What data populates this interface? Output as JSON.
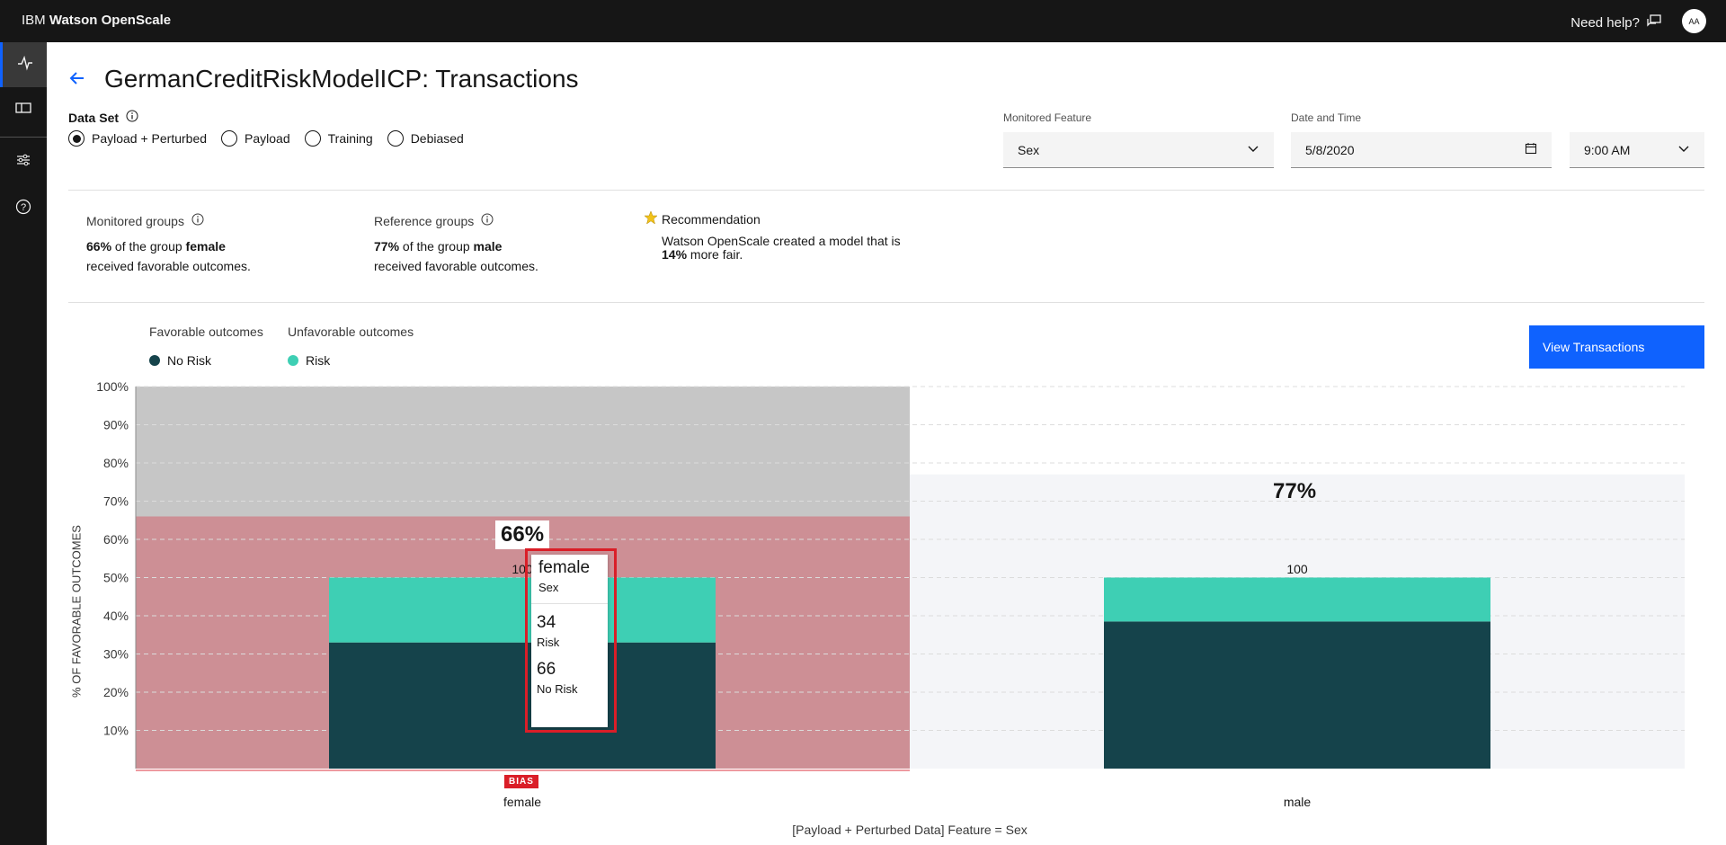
{
  "header": {
    "brand_prefix": "IBM",
    "brand_name": "Watson OpenScale",
    "help_label": "Need help?",
    "avatar_initials": "AA"
  },
  "page": {
    "title": "GermanCreditRiskModelICP: Transactions"
  },
  "dataset": {
    "label": "Data Set",
    "options": [
      "Payload + Perturbed",
      "Payload",
      "Training",
      "Debiased"
    ],
    "selected": "Payload + Perturbed"
  },
  "filters": {
    "monitored_feature_label": "Monitored Feature",
    "monitored_feature_value": "Sex",
    "date_label": "Date and Time",
    "date_value": "5/8/2020",
    "time_value": "9:00 AM"
  },
  "summary": {
    "monitored_label": "Monitored groups",
    "monitored_pct": "66%",
    "monitored_text_a": "of the group",
    "monitored_group": "female",
    "monitored_text_b": "received favorable outcomes.",
    "reference_label": "Reference groups",
    "reference_pct": "77%",
    "reference_text_a": "of the group",
    "reference_group": "male",
    "reference_text_b": "received favorable outcomes.",
    "recommendation_label": "Recommendation",
    "recommendation_text_a": "Watson OpenScale created a model that is",
    "recommendation_pct": "14%",
    "recommendation_text_b": "more fair."
  },
  "legend": {
    "favorable_label": "Favorable outcomes",
    "favorable_item": "No Risk",
    "unfavorable_label": "Unfavorable outcomes",
    "unfavorable_item": "Risk"
  },
  "actions": {
    "view_transactions": "View Transactions"
  },
  "colors": {
    "no_risk": "#15434b",
    "risk": "#3ecfb4",
    "bias_region": "#cd8f95",
    "unfav_region": "#c6c6c6",
    "accent": "#0f62fe",
    "bias_red": "#da1e28"
  },
  "chart_data": {
    "type": "bar",
    "categories": [
      "female",
      "male"
    ],
    "yticks": [
      "10%",
      "20%",
      "30%",
      "40%",
      "50%",
      "60%",
      "70%",
      "80%",
      "90%",
      "100%"
    ],
    "ylim": [
      0,
      100
    ],
    "ylabel": "% OF FAVORABLE OUTCOMES",
    "xlabel": "[Payload + Perturbed Data] Feature = Sex",
    "favorable_pct": [
      66,
      77
    ],
    "bar_top_labels": [
      "100",
      "100"
    ],
    "series": [
      {
        "name": "No Risk",
        "values": [
          66,
          77
        ]
      },
      {
        "name": "Risk",
        "values": [
          34,
          23
        ]
      }
    ],
    "bias_badge": "BIAS",
    "pct_labels": [
      "66%",
      "77%"
    ],
    "tooltip": {
      "group": "female",
      "feature": "Sex",
      "risk_value": "34",
      "risk_label": "Risk",
      "norisk_value": "66",
      "norisk_label": "No Risk"
    }
  }
}
